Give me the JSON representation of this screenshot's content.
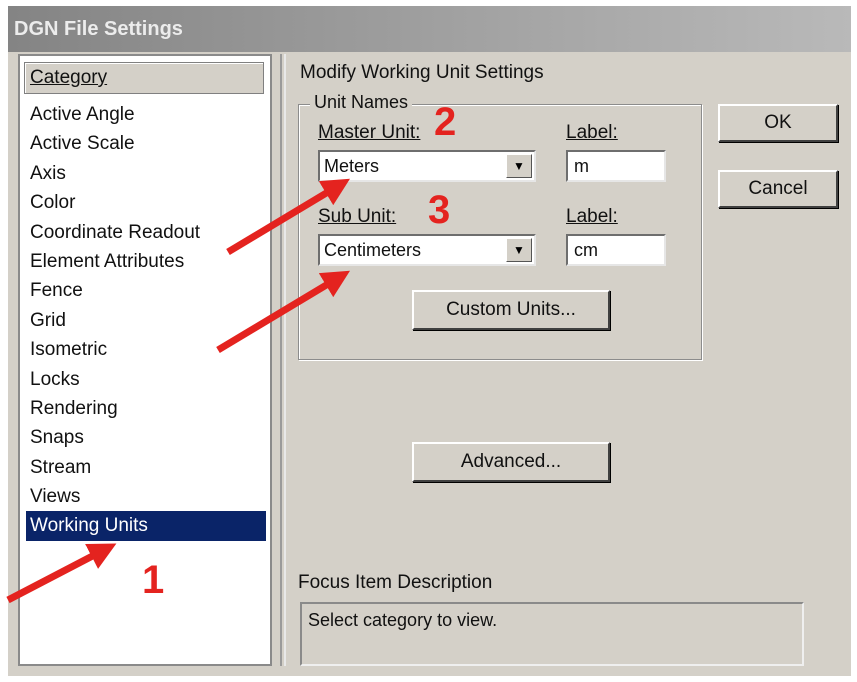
{
  "window": {
    "title": "DGN File Settings"
  },
  "category": {
    "header": "Category",
    "items": [
      "Active Angle",
      "Active Scale",
      "Axis",
      "Color",
      "Coordinate Readout",
      "Element Attributes",
      "Fence",
      "Grid",
      "Isometric",
      "Locks",
      "Rendering",
      "Snaps",
      "Stream",
      "Views",
      "Working Units"
    ],
    "selected": "Working Units"
  },
  "main": {
    "section_title": "Modify Working Unit Settings",
    "group": {
      "legend": "Unit Names",
      "master_unit_label": "Master Unit:",
      "master_unit_value": "Meters",
      "master_label_label": "Label:",
      "master_label_value": "m",
      "sub_unit_label": "Sub Unit:",
      "sub_unit_value": "Centimeters",
      "sub_label_label": "Label:",
      "sub_label_value": "cm",
      "custom_units_button": "Custom Units..."
    },
    "advanced_button": "Advanced...",
    "focus_title": "Focus Item Description",
    "focus_text": "Select category to view."
  },
  "buttons": {
    "ok": "OK",
    "cancel": "Cancel"
  },
  "annotations": {
    "step1": "1",
    "step2": "2",
    "step3": "3",
    "color": "#e4231f"
  },
  "icons": {
    "dropdown": "chevron-down-icon",
    "arrows": "red-arrow-icon"
  }
}
